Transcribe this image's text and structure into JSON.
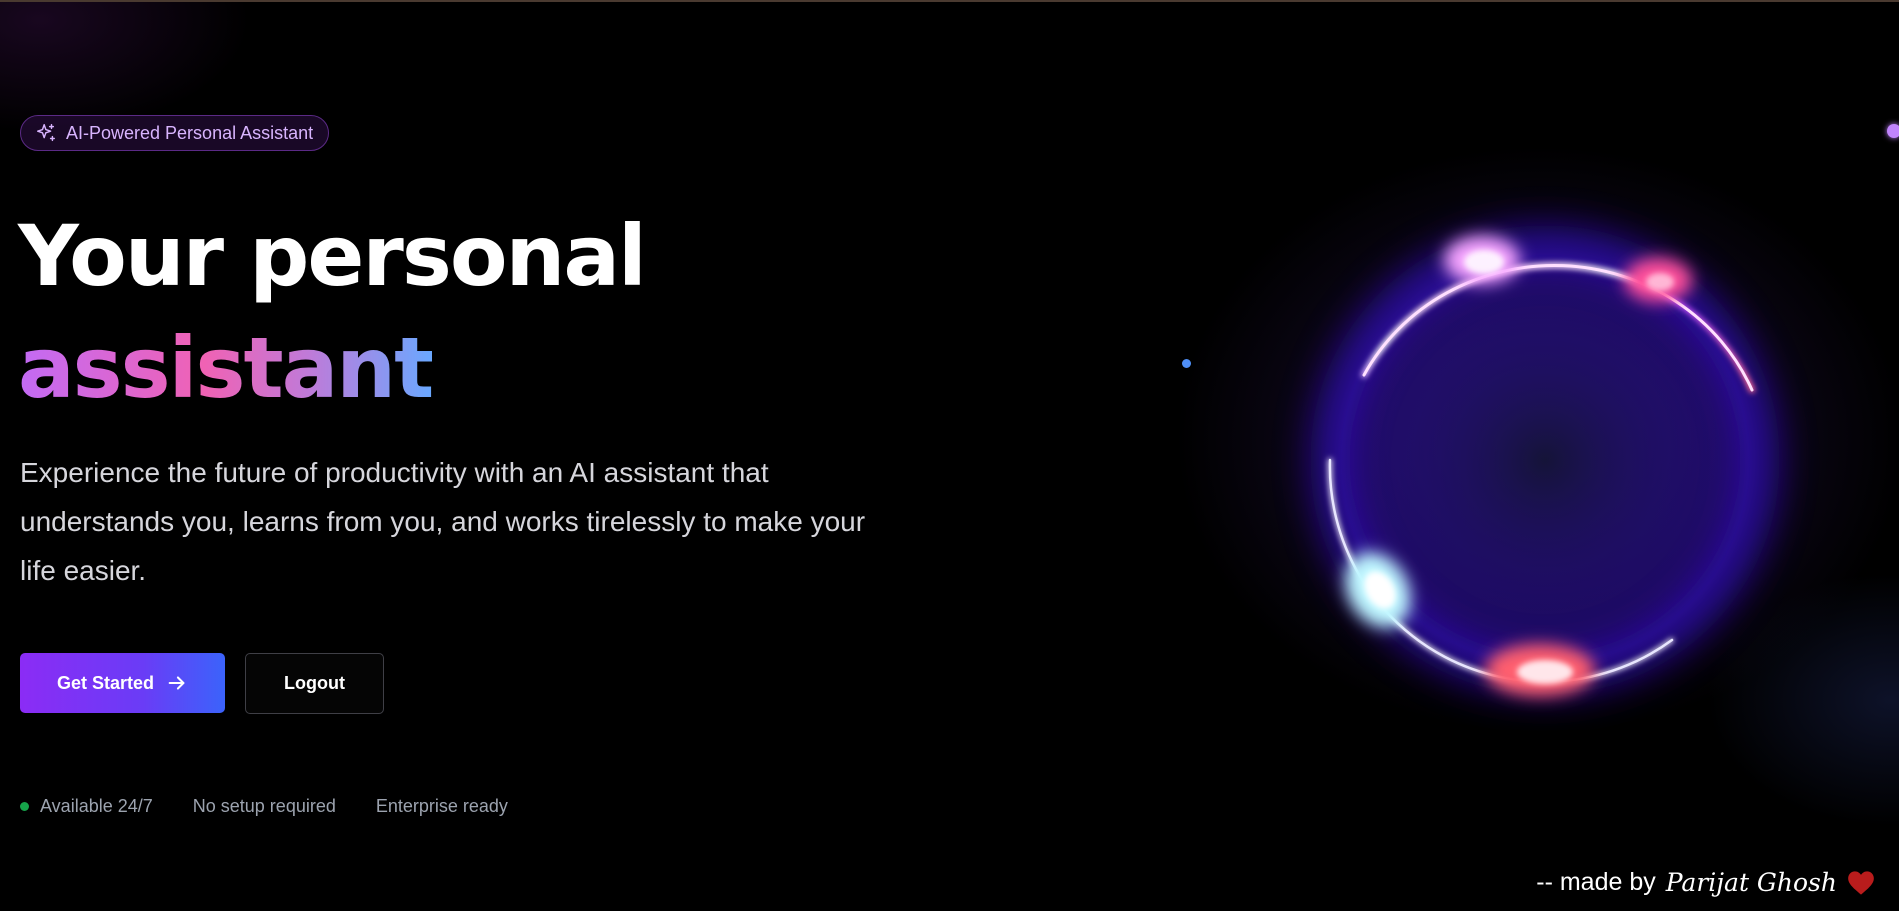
{
  "badge": {
    "icon": "sparkles-icon",
    "label": "AI-Powered Personal Assistant"
  },
  "hero": {
    "title_line1": "Your personal",
    "title_line2": "assistant",
    "subtitle": "Experience the future of productivity with an AI assistant that understands you, learns from you, and works tirelessly to make your life easier."
  },
  "actions": {
    "primary_label": "Get Started",
    "primary_icon": "arrow-right-icon",
    "secondary_label": "Logout"
  },
  "features": [
    {
      "label": "Available 24/7",
      "status_color": "#16a34a"
    },
    {
      "label": "No setup required"
    },
    {
      "label": "Enterprise ready"
    }
  ],
  "credit": {
    "prefix": "-- made by",
    "author": "Parijat Ghosh",
    "icon": "heart-icon",
    "heart_color": "#b91c1c"
  },
  "colors": {
    "accent_purple": "#8b2cf5",
    "accent_blue": "#3b63fb",
    "gradient_pink": "#f062b4"
  }
}
